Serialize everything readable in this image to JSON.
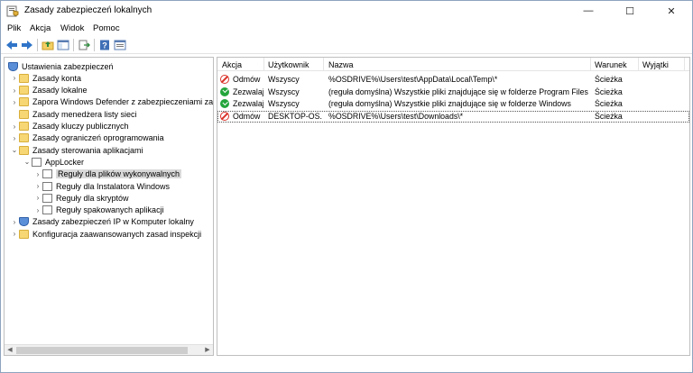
{
  "window": {
    "title": "Zasady zabezpieczeń lokalnych",
    "min_glyph": "—",
    "max_glyph": "☐",
    "close_glyph": "✕"
  },
  "menu": [
    "Plik",
    "Akcja",
    "Widok",
    "Pomoc"
  ],
  "toolbar": {
    "icons": [
      "back-icon",
      "forward-icon",
      "up-folder-icon",
      "show-hide-tree-icon",
      "export-list-icon",
      "help-icon",
      "properties-icon"
    ]
  },
  "tree": {
    "items": [
      {
        "label": "Ustawienia zabezpieczeń",
        "level": 0,
        "expander": "",
        "icon": "shield"
      },
      {
        "label": "Zasady konta",
        "level": 1,
        "expander": "›",
        "icon": "folder"
      },
      {
        "label": "Zasady lokalne",
        "level": 1,
        "expander": "›",
        "icon": "folder"
      },
      {
        "label": "Zapora Windows Defender z zabezpieczeniami zaaw",
        "level": 1,
        "expander": "›",
        "icon": "folder"
      },
      {
        "label": "Zasady menedżera listy sieci",
        "level": 1,
        "expander": "",
        "icon": "folder"
      },
      {
        "label": "Zasady kluczy publicznych",
        "level": 1,
        "expander": "›",
        "icon": "folder"
      },
      {
        "label": "Zasady ograniczeń oprogramowania",
        "level": 1,
        "expander": "›",
        "icon": "folder"
      },
      {
        "label": "Zasady sterowania aplikacjami",
        "level": 1,
        "expander": "⌄",
        "icon": "folder"
      },
      {
        "label": "AppLocker",
        "level": 2,
        "expander": "⌄",
        "icon": "doc"
      },
      {
        "label": "Reguły dla plików wykonywalnych",
        "level": 3,
        "expander": "›",
        "icon": "doc",
        "selected": true
      },
      {
        "label": "Reguły dla Instalatora Windows",
        "level": 3,
        "expander": "›",
        "icon": "doc"
      },
      {
        "label": "Reguły dla skryptów",
        "level": 3,
        "expander": "›",
        "icon": "doc"
      },
      {
        "label": "Reguły spakowanych aplikacji",
        "level": 3,
        "expander": "›",
        "icon": "doc"
      },
      {
        "label": "Zasady zabezpieczeń IP w Komputer lokalny",
        "level": 1,
        "expander": "›",
        "icon": "shield"
      },
      {
        "label": "Konfiguracja zaawansowanych zasad inspekcji",
        "level": 1,
        "expander": "›",
        "icon": "folder"
      }
    ]
  },
  "list": {
    "columns": [
      "Akcja",
      "Użytkownik",
      "Nazwa",
      "Warunek",
      "Wyjątki"
    ],
    "rows": [
      {
        "status": "deny",
        "akcja": "Odmów",
        "user": "Wszyscy",
        "name": "%OSDRIVE%\\Users\\test\\AppData\\Local\\Temp\\*",
        "condition": "Ścieżka",
        "exceptions": ""
      },
      {
        "status": "allow",
        "akcja": "Zezwalaj",
        "user": "Wszyscy",
        "name": "(reguła domyślna) Wszystkie pliki znajdujące się w folderze Program Files",
        "condition": "Ścieżka",
        "exceptions": ""
      },
      {
        "status": "allow",
        "akcja": "Zezwalaj",
        "user": "Wszyscy",
        "name": "(reguła domyślna) Wszystkie pliki znajdujące się w folderze Windows",
        "condition": "Ścieżka",
        "exceptions": ""
      },
      {
        "status": "deny",
        "akcja": "Odmów",
        "user": "DESKTOP-OS...",
        "name": "%OSDRIVE%\\Users\\test\\Downloads\\*",
        "condition": "Ścieżka",
        "exceptions": "",
        "focused": true
      }
    ]
  }
}
